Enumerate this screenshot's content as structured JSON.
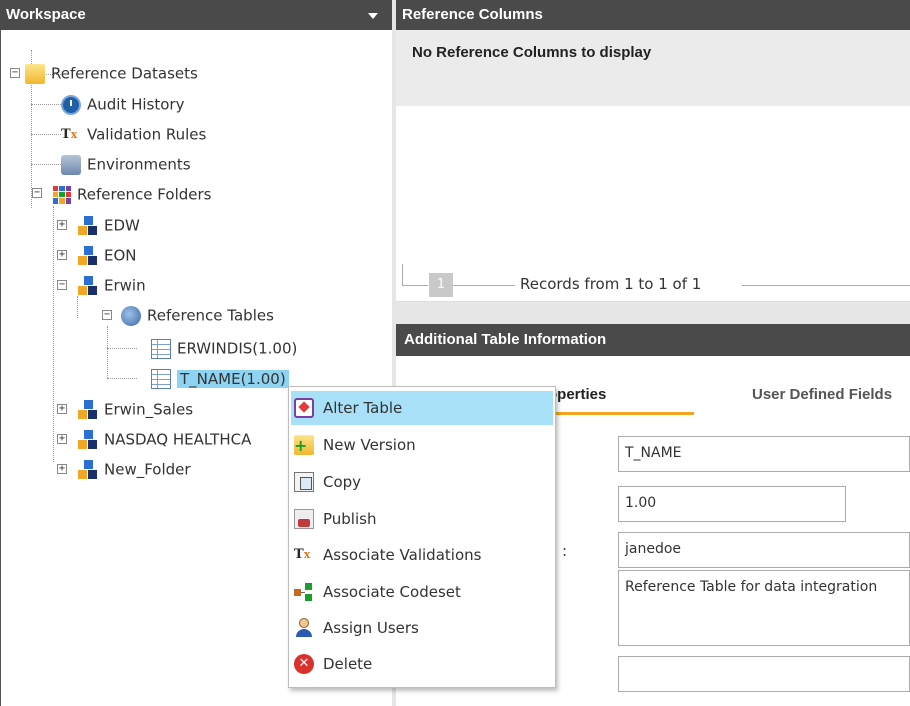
{
  "workspace": {
    "title": "Workspace",
    "tree": {
      "root_label": "Reference Datasets",
      "audit_history": "Audit History",
      "validation_rules": "Validation Rules",
      "environments": "Environments",
      "reference_folders": "Reference Folders",
      "folders": {
        "edw": "EDW",
        "eon": "EON",
        "erwin": "Erwin",
        "erwin_sales": "Erwin_Sales",
        "nasdaq": "NASDAQ HEALTHCA",
        "new_folder": "New_Folder"
      },
      "reference_tables": "Reference Tables",
      "tables": {
        "erwindis": "ERWINDIS(1.00)",
        "t_name": "T_NAME(1.00)"
      }
    }
  },
  "reference_columns": {
    "title": "Reference Columns",
    "empty_message": "No Reference Columns to display",
    "pager": {
      "page": "1",
      "records": "Records from 1 to 1 of 1"
    }
  },
  "additional_info": {
    "title": "Additional Table Information",
    "tabs": {
      "properties": "operties",
      "user_defined": "User Defined Fields"
    },
    "owner_label_tail": ":",
    "fields": {
      "name": "T_NAME",
      "version": "1.00",
      "owner": "janedoe",
      "description": "Reference Table for data integration",
      "extra": ""
    }
  },
  "context_menu": {
    "items": {
      "alter_table": "Alter Table",
      "new_version": "New Version",
      "copy": "Copy",
      "publish": "Publish",
      "associate_validations": "Associate Validations",
      "associate_codeset": "Associate Codeset",
      "assign_users": "Assign Users",
      "delete": "Delete"
    }
  },
  "colors": {
    "header_bg": "#4a4a4a",
    "selection": "#8fd3f2",
    "menu_hover": "#a8e0f7",
    "tab_accent": "#f3a41f"
  }
}
